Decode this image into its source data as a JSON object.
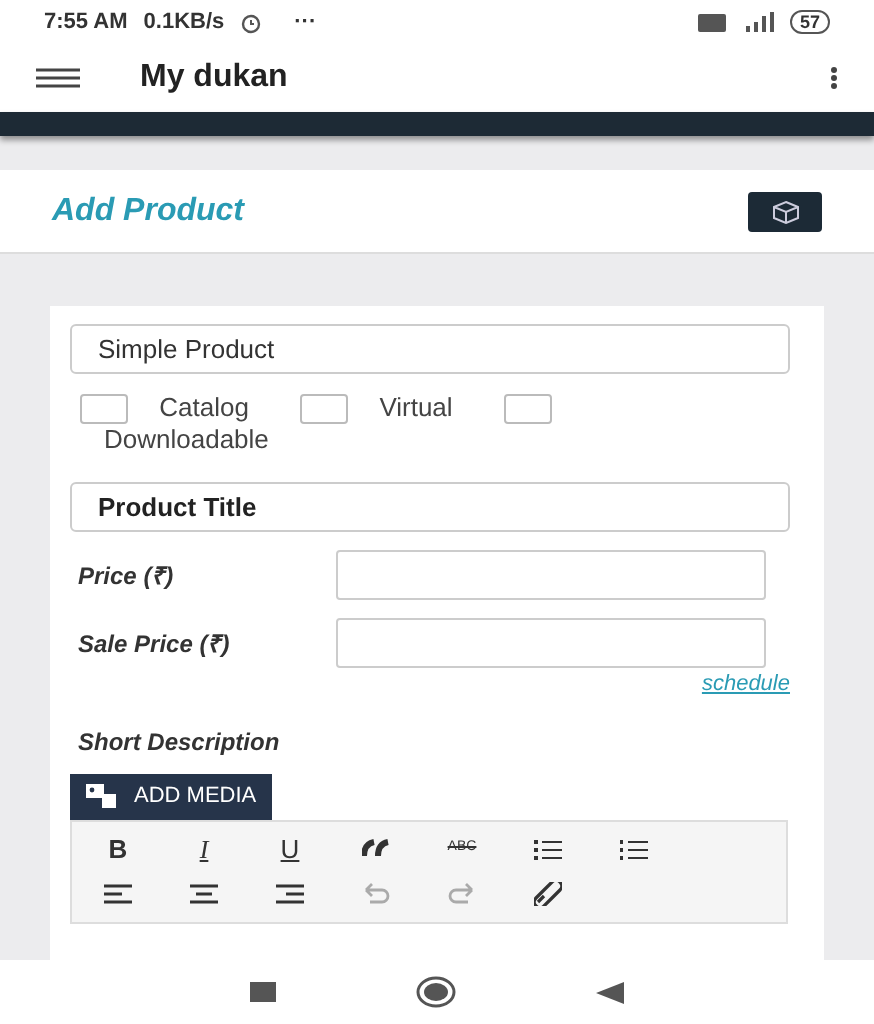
{
  "status_bar": {
    "time": "7:55 AM",
    "speed": "0.1KB/s",
    "more": "···",
    "battery": "57"
  },
  "app_bar": {
    "title": "My dukan"
  },
  "header": {
    "title": "Add Product"
  },
  "form": {
    "product_type": {
      "value": "Simple Product"
    },
    "options": [
      {
        "label": "Catalog",
        "checked": false
      },
      {
        "label": "Virtual",
        "checked": false
      },
      {
        "label": "Downloadable",
        "checked": false
      }
    ],
    "title_field": {
      "placeholder": "Product Title"
    },
    "price": {
      "label": "Price (₹)"
    },
    "sale_price": {
      "label": "Sale Price (₹)",
      "link": "schedule"
    },
    "short_description": {
      "label": "Short Description",
      "add_media": "ADD MEDIA",
      "toolbar": [
        {
          "kind": "bold",
          "label": "B",
          "disabled": false
        },
        {
          "kind": "italic",
          "label": "I",
          "disabled": false
        },
        {
          "kind": "underline",
          "label": "U",
          "disabled": false
        },
        {
          "kind": "quote",
          "disabled": false
        },
        {
          "kind": "strike",
          "label": "ABC",
          "disabled": false
        },
        {
          "kind": "bullets",
          "disabled": false
        },
        {
          "kind": "numbers",
          "disabled": false
        },
        {
          "kind": "align-left",
          "disabled": false
        },
        {
          "kind": "align-center",
          "disabled": false
        },
        {
          "kind": "align-right",
          "disabled": false
        },
        {
          "kind": "undo",
          "disabled": true
        },
        {
          "kind": "redo",
          "disabled": true
        },
        {
          "kind": "link",
          "disabled": false
        }
      ]
    }
  }
}
